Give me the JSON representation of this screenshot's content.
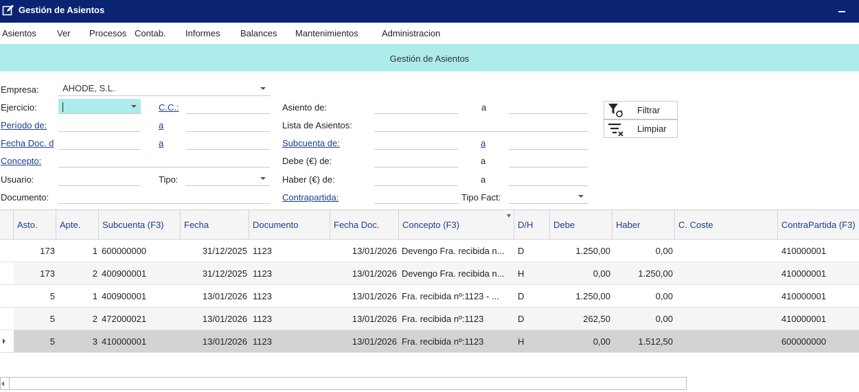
{
  "window": {
    "title": "Gestión de Asientos",
    "icon": "edit-icon"
  },
  "menu": [
    "Asientos",
    "Ver",
    "Procesos",
    "Contab.",
    "Informes",
    "Balances",
    "Mantenimientos",
    "Administracion"
  ],
  "header": {
    "title": "Gestión de Asientos"
  },
  "form": {
    "empresa_label": "Empresa:",
    "empresa_value": "AHODE, S.L.",
    "ejercicio_label": "Ejercicio:",
    "cc_label": "C.C.:",
    "periodo_label": "Período de:",
    "periodo_a": "a",
    "fecha_doc_label": "Fecha Doc. d",
    "fecha_doc_a": "a",
    "concepto_label": "Concepto:",
    "usuario_label": "Usuario:",
    "tipo_label": "Tipo:",
    "documento_label": "Documento:",
    "asiento_de_label": "Asiento de:",
    "asiento_a": "a",
    "lista_asientos_label": "Lista de Asientos:",
    "subcuenta_de_label": "Subcuenta de:",
    "subcuenta_a": "a",
    "debe_de_label": "Debe (€) de:",
    "debe_a": "a",
    "haber_de_label": "Haber (€) de:",
    "haber_a": "a",
    "contrapartida_label": "Contrapartida:",
    "tipo_fact_label": "Tipo Fact:"
  },
  "buttons": {
    "filtrar": "Filtrar",
    "limpiar": "Limpiar"
  },
  "table": {
    "columns": [
      "Asto.",
      "Apte.",
      "Subcuenta (F3)",
      "Fecha",
      "Documento",
      "Fecha Doc.",
      "Concepto (F3)",
      "D/H",
      "Debe",
      "Haber",
      "C. Coste",
      "ContraPartida (F3)"
    ],
    "rows": [
      [
        "173",
        "1",
        "600000000",
        "31/12/2025",
        "1123",
        "13/01/2026",
        "Devengo Fra. recibida n...",
        "D",
        "1.250,00",
        "0,00",
        "",
        "410000001"
      ],
      [
        "173",
        "2",
        "400900001",
        "31/12/2025",
        "1123",
        "13/01/2026",
        "Devengo Fra. recibida n...",
        "H",
        "0,00",
        "1.250,00",
        "",
        "410000001"
      ],
      [
        "5",
        "1",
        "400900001",
        "13/01/2026",
        "1123",
        "13/01/2026",
        "Fra. recibida nº:1123 - ...",
        "D",
        "1.250,00",
        "0,00",
        "",
        "410000001"
      ],
      [
        "5",
        "2",
        "472000021",
        "13/01/2026",
        "1123",
        "13/01/2026",
        "Fra. recibida nº:1123",
        "D",
        "262,50",
        "0,00",
        "",
        "410000001"
      ],
      [
        "5",
        "3",
        "410000001",
        "13/01/2026",
        "1123",
        "13/01/2026",
        "Fra. recibida nº:1123",
        "H",
        "0,00",
        "1.512,50",
        "",
        "600000000"
      ]
    ],
    "selected_row": 4
  },
  "colors": {
    "titlebar": "#0a2472",
    "band": "#aeebeb",
    "link": "#1a3d8f"
  }
}
